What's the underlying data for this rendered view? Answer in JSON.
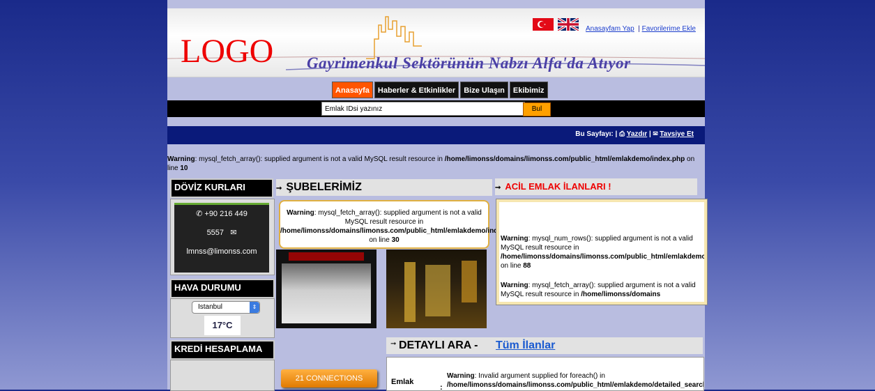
{
  "header": {
    "logo": "LOGO",
    "slogan": "Gayrimenkul Sektörünün Nabzı Alfa'da Atıyor",
    "links": [
      "Anasayfam Yap",
      "|",
      "Favorilerime Ekle"
    ]
  },
  "nav": {
    "items": [
      "Anasayfa",
      "Haberler & Etkinlikler",
      "Bize Ulaşın",
      "Ekibimiz"
    ]
  },
  "search": {
    "placeholder": "Emlak IDsi yazınız",
    "button": "Bul"
  },
  "page_tools": {
    "label": "Bu Sayfayı: |",
    "print": "Yazdır",
    "sep": "|",
    "recommend": "Tavsiye Et"
  },
  "warnings": {
    "top": {
      "label": "Warning",
      "text": ": mysql_fetch_array(): supplied argument is not a valid MySQL result resource in ",
      "path": "/home/limonss/domains/limonss.com/public_html/emlakdemo/index.php",
      "line_prefix": " on line ",
      "line": "10"
    },
    "subeler": {
      "label": "Warning",
      "text": ": mysql_fetch_array(): supplied argument is not a valid MySQL result resource in ",
      "path": "/home/limonss/domains/limonss.com/public_html/emlakdemo/index_cats.php",
      "line_prefix": " on line ",
      "line": "30"
    },
    "acil1": {
      "label": "Warning",
      "text": ": mysql_num_rows(): supplied argument is not a valid MySQL result resource in ",
      "path": "/home/limonss/domains/limonss.com/public_html/emlakdemo/index.php",
      "line_prefix": " on line ",
      "line": "88"
    },
    "acil2": {
      "label": "Warning",
      "text": ": mysql_fetch_array(): supplied argument is not a valid MySQL result resource in ",
      "path": "/home/limonss/domains"
    },
    "detay": {
      "label": "Warning",
      "text": ": Invalid argument supplied for foreach() in ",
      "path": "/home/limonss/domains/limonss.com/public_html/emlakdemo/detailed_search.php",
      "line_prefix": " on"
    }
  },
  "sidebar": {
    "doviz_title": "DÖVİZ KURLARI",
    "phone": "+90 216 449",
    "phone2": "5557",
    "email": "lmnss@limonss.com",
    "hava_title": "HAVA DURUMU",
    "city": "Istanbul",
    "temp": "17°C",
    "kredi_title": "KREDİ HESAPLAMA"
  },
  "sections": {
    "subeler": "ŞUBELERİMİZ",
    "acil": "ACİL EMLAK İLANLARI !",
    "detay": "DETAYLI ARA -",
    "detay_link": "Tüm İlanlar",
    "emlak_label": "Emlak",
    "colon": ":"
  },
  "connections_button": "21 CONNECTIONS",
  "colors": {
    "accent": "#ff5500",
    "nav_bg": "#111111",
    "bluebar": "#0a1a7a",
    "logo_red": "#ee0000",
    "slogan_purple": "#4a3fa6",
    "acil_red": "#ee0000"
  }
}
